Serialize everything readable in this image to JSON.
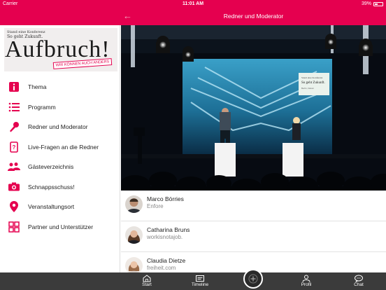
{
  "status_bar": {
    "carrier": "Carrier",
    "time": "11:01 AM",
    "battery": "39%"
  },
  "nav": {
    "title": "Redner und Moderator",
    "back_icon": "back-arrow-icon"
  },
  "logo": {
    "line1": "Stand eine Konferenz",
    "line2": "So geht Zukunft.",
    "wordmark": "Aufbruch!",
    "stamp": "WIR KÖNNEN AUCH ANDERS"
  },
  "menu": [
    {
      "label": "Thema",
      "icon": "info-icon"
    },
    {
      "label": "Programm",
      "icon": "list-icon"
    },
    {
      "label": "Redner und Moderator",
      "icon": "microphone-icon"
    },
    {
      "label": "Live-Fragen an die Redner",
      "icon": "phone-question-icon"
    },
    {
      "label": "Gästeverzeichnis",
      "icon": "people-icon"
    },
    {
      "label": "Schnappsschuss!",
      "icon": "camera-icon"
    },
    {
      "label": "Veranstaltungsort",
      "icon": "location-pin-icon"
    },
    {
      "label": "Partner und Unterstützer",
      "icon": "puzzle-icon"
    }
  ],
  "hero": {
    "screen_line1": "Stand eine Konferenz",
    "screen_line2": "So geht Zukunft.",
    "screen_line3": "Berlin, Datum"
  },
  "speakers": [
    {
      "name": "Marco Börries",
      "org": "Enfore"
    },
    {
      "name": "Catharina Bruns",
      "org": "workisnotajob."
    },
    {
      "name": "Claudia Dietze",
      "org": "freiheit.com"
    }
  ],
  "tabs": [
    {
      "label": "Start",
      "icon": "home-icon"
    },
    {
      "label": "Timeline",
      "icon": "timeline-icon"
    },
    {
      "label": "Profil",
      "icon": "profile-icon"
    },
    {
      "label": "Chat",
      "icon": "chat-icon"
    }
  ],
  "colors": {
    "accent": "#e5004f",
    "tabbar": "#3b3b3b",
    "text": "#222222",
    "subtext": "#888888"
  }
}
